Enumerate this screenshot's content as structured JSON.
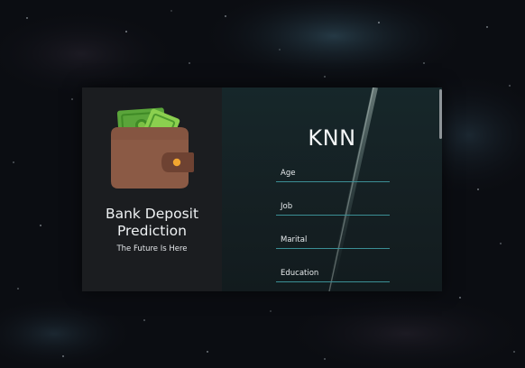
{
  "app": {
    "title_line1": "Bank Deposit",
    "title_line2": "Prediction",
    "tagline": "The Future Is Here",
    "icon": "wallet-with-cash-icon"
  },
  "form": {
    "model_title": "KNN",
    "fields": [
      {
        "label": "Age"
      },
      {
        "label": "Job"
      },
      {
        "label": "Marital"
      },
      {
        "label": "Education"
      }
    ]
  },
  "colors": {
    "left_panel": "#1b1d20",
    "right_panel": "#152023",
    "field_underline": "#3b8f95",
    "wallet": "#8b5a45",
    "cash": "#7cc044"
  }
}
